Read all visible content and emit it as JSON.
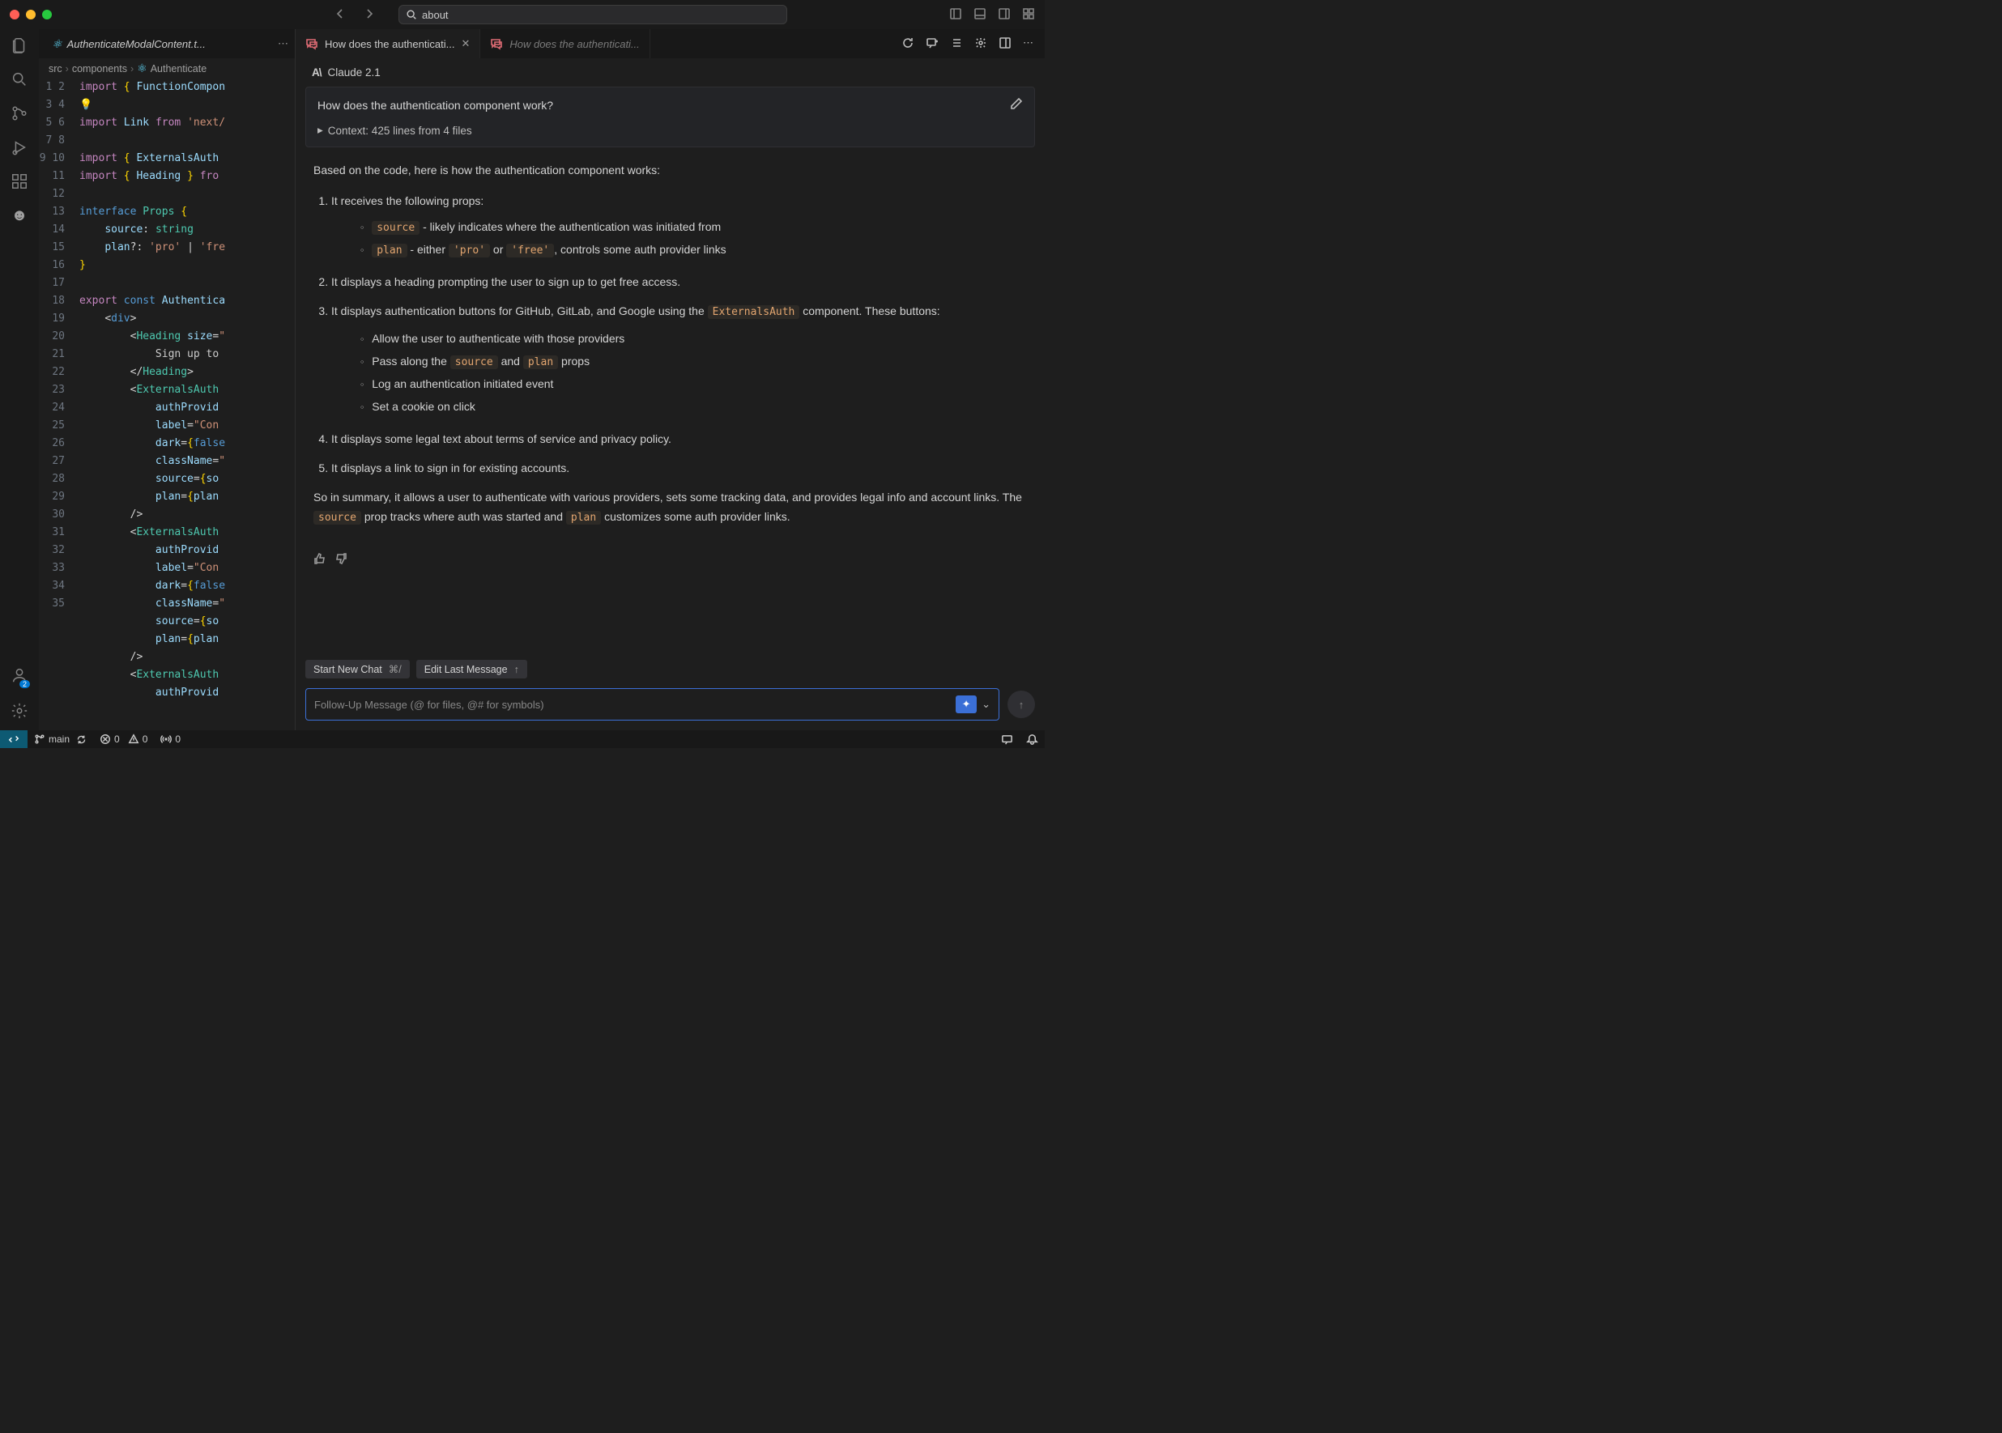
{
  "search": {
    "value": "about",
    "icon": "search-icon"
  },
  "editor": {
    "tab_name": "AuthenticateModalContent.t...",
    "breadcrumb": {
      "p1": "src",
      "p2": "components",
      "p3": "Authenticate"
    },
    "lines": [
      1,
      2,
      3,
      4,
      5,
      6,
      7,
      8,
      9,
      10,
      11,
      12,
      13,
      14,
      15,
      16,
      17,
      18,
      19,
      20,
      21,
      22,
      23,
      24,
      25,
      26,
      27,
      28,
      29,
      30,
      31,
      32,
      33,
      34,
      35
    ]
  },
  "chat": {
    "tabs": {
      "active": "How does the authenticati...",
      "inactive": "How does the authenticati..."
    },
    "model": "Claude 2.1",
    "question": "How does the authentication component work?",
    "context": "Context: 425 lines from 4 files",
    "answer": {
      "intro": "Based on the code, here is how the authentication component works:",
      "li1": "It receives the following props:",
      "li1a_pre": " - likely indicates where the authentication was initiated from",
      "li1b_mid": " - either ",
      "li1b_or": " or ",
      "li1b_post": ", controls some auth provider links",
      "li2": "It displays a heading prompting the user to sign up to get free access.",
      "li3_pre": "It displays authentication buttons for GitHub, GitLab, and Google using the ",
      "li3_post": " component. These buttons:",
      "li3a": "Allow the user to authenticate with those providers",
      "li3b_pre": "Pass along the ",
      "li3b_and": " and ",
      "li3b_post": " props",
      "li3c": "Log an authentication initiated event",
      "li3d": "Set a cookie on click",
      "li4": "It displays some legal text about terms of service and privacy policy.",
      "li5": "It displays a link to sign in for existing accounts.",
      "summary_pre": "So in summary, it allows a user to authenticate with various providers, sets some tracking data, and provides legal info and account links. The ",
      "summary_mid": " prop tracks where auth was started and ",
      "summary_post": " customizes some auth provider links.",
      "code": {
        "source": "source",
        "plan": "plan",
        "pro": "'pro'",
        "free": "'free'",
        "ext": "ExternalsAuth"
      }
    },
    "actions": {
      "new_chat": "Start New Chat",
      "new_chat_key": "⌘/",
      "edit_last": "Edit Last Message",
      "edit_last_key": "↑"
    },
    "input_placeholder": "Follow-Up Message (@ for files, @# for symbols)"
  },
  "statusbar": {
    "branch": "main",
    "errors": "0",
    "warnings": "0",
    "ports": "0",
    "badge": "2"
  }
}
